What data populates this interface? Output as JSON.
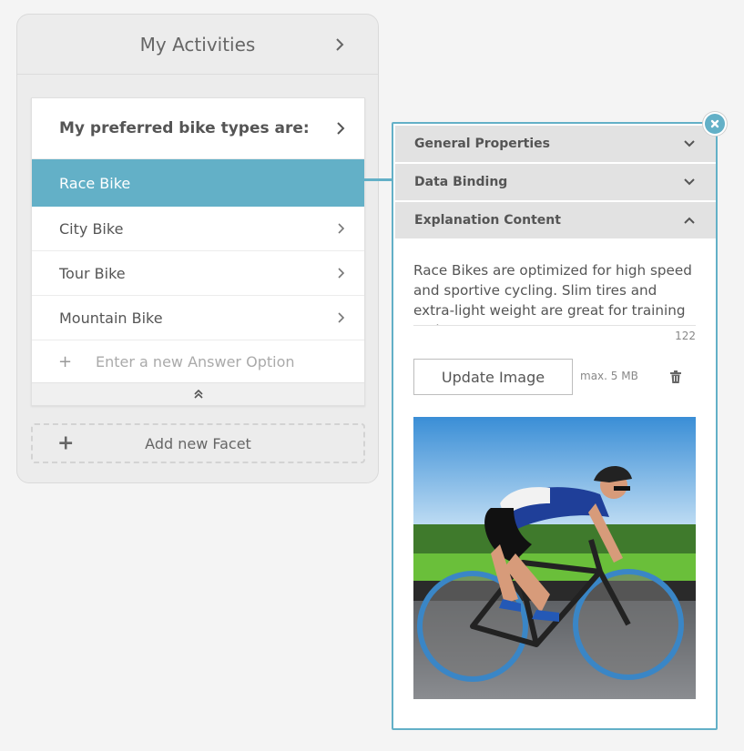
{
  "left_panel": {
    "title": "My Activities",
    "question": "My preferred bike types are:",
    "options": [
      "Race Bike",
      "City Bike",
      "Tour Bike",
      "Mountain Bike"
    ],
    "selected_option": "Race Bike",
    "new_option_placeholder": "Enter a new Answer Option",
    "add_facet_label": "Add new Facet"
  },
  "right_panel": {
    "sections": [
      {
        "label": "General Properties",
        "expanded": false
      },
      {
        "label": "Data Binding",
        "expanded": false
      },
      {
        "label": "Explanation Content",
        "expanded": true
      }
    ],
    "explanation_text": "Race Bikes are optimized for high speed and sportive cycling. Slim tires and extra-light weight are great for training and",
    "char_count": "122",
    "update_image_label": "Update Image",
    "max_size": "max. 5 MB"
  },
  "colors": {
    "accent": "#63b0c7",
    "background": "#f4f4f4",
    "panel": "#ececec"
  },
  "icons": [
    "chevron-right-icon",
    "chevron-down-icon",
    "chevron-up-icon",
    "double-chevron-up-icon",
    "plus-icon",
    "close-icon",
    "trash-icon"
  ]
}
